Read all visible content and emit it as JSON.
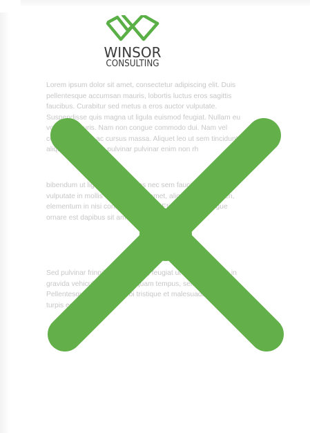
{
  "logo": {
    "name": "WINSOR",
    "subtitle": "CONSULTING",
    "icon": "double-chevron-logo-icon",
    "color": "#5ab046"
  },
  "paragraphs": [
    "Lorem ipsum dolor sit amet, consectetur adipiscing elit. Duis pellentesque accumsan mauris, lobortis luctus eros sagittis faucibus. Curabitur sed metus a eros auctor vulputate. Suspendisse quis magna ut ligula euismod feugiat. Nullam eu volutpat mauris. Nam non congue commodo dui. Nam vel convallis lacus, ac cursus massa. Aliquet leo ut sem tincidunt, at aliquam ex ultrices pulvinar pulvinar enim non rh",
    "bibendum ut ligula diam ultrices nec sem faucibus massa vulputate in mollis vel ultrices sit amet, aliquet libero sapien, elementum in nisi consectetur enim. Etiam ornare congue ornare est dapibus sit amet. Nulla lacinia.",
    "Sed pulvinar fringilla mollis dolor, feugiat ut lobortis Mauris in gravida vehicula eu sem vel quam tempus, semper ut Pellentesque habitant morbi tristique et malesuada fames ac turpis egestas et mal"
  ],
  "overlay": {
    "icon": "reject-x-icon",
    "color": "#63b04a"
  }
}
